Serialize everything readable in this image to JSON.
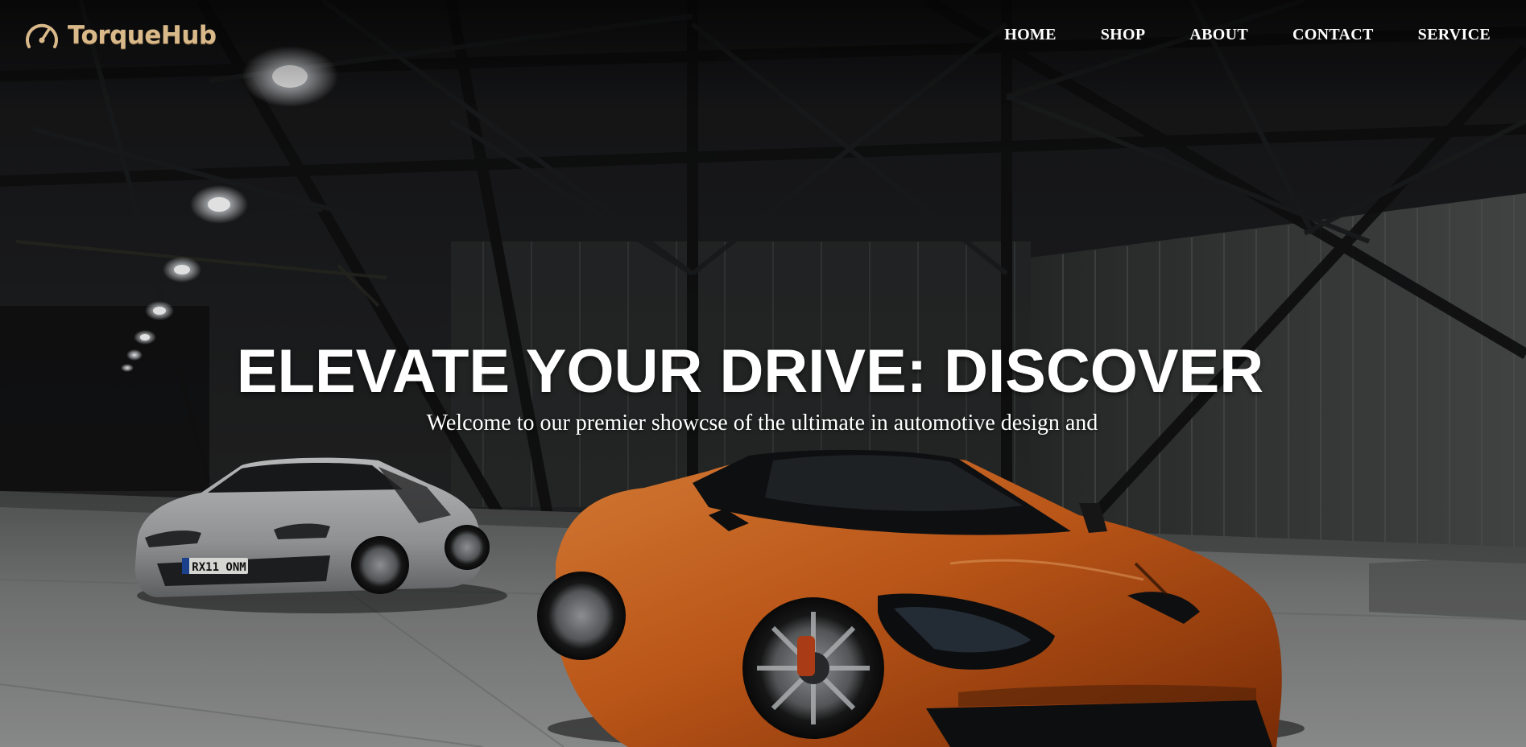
{
  "brand": {
    "name": "TorqueHub",
    "logo_icon": "speedometer-icon",
    "accent_color": "#d9b98a"
  },
  "nav": {
    "items": [
      {
        "label": "HOME"
      },
      {
        "label": "SHOP"
      },
      {
        "label": "ABOUT"
      },
      {
        "label": "CONTACT"
      },
      {
        "label": "SERVICE"
      }
    ]
  },
  "hero": {
    "title": "ELEVATE YOUR DRIVE: DISCOVER",
    "subtitle": "Welcome to our premier showcse of the ultimate in automotive design and",
    "background": "dark warehouse with silver and orange supercars",
    "plate_text": "RX11 ONM"
  }
}
